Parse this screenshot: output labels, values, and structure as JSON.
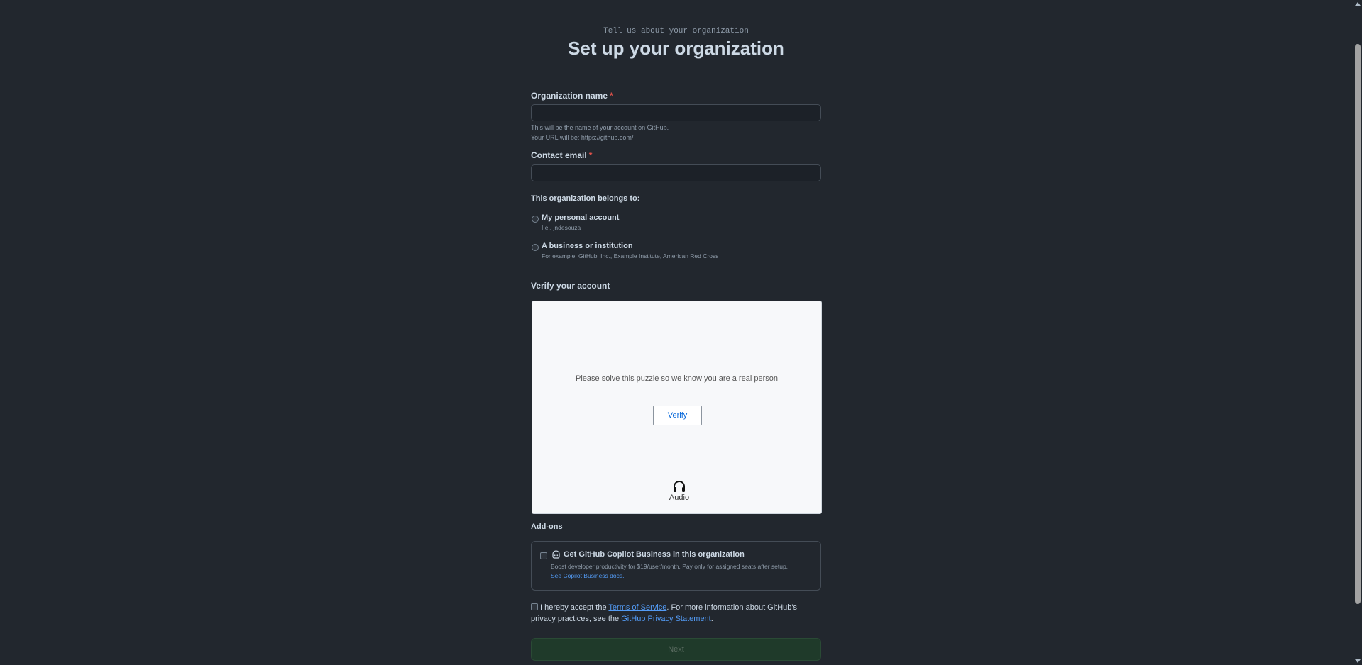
{
  "header": {
    "eyebrow": "Tell us about your organization",
    "title": "Set up your organization"
  },
  "org_name": {
    "label": "Organization name",
    "required_mark": "*",
    "value": "",
    "hint_line1": "This will be the name of your account on GitHub.",
    "hint_line2": "Your URL will be: https://github.com/"
  },
  "contact_email": {
    "label": "Contact email",
    "required_mark": "*",
    "value": ""
  },
  "belongs_to": {
    "label": "This organization belongs to:",
    "options": [
      {
        "title": "My personal account",
        "desc": "I.e., jndesouza",
        "selected": false
      },
      {
        "title": "A business or institution",
        "desc": "For example: GitHub, Inc., Example Institute, American Red Cross",
        "selected": false
      }
    ]
  },
  "verify": {
    "title": "Verify your account",
    "message": "Please solve this puzzle so we know you are a real person",
    "button": "Verify",
    "audio_label": "Audio",
    "audio_icon": "headphones-icon"
  },
  "addons": {
    "title": "Add-ons",
    "copilot": {
      "icon": "copilot-icon",
      "title": "Get GitHub Copilot Business in this organization",
      "desc": "Boost developer productivity for $19/user/month. Pay only for assigned seats after setup.",
      "link": "See Copilot Business docs.",
      "checked": false
    }
  },
  "terms": {
    "prefix": "I hereby accept the",
    "tos_link": "Terms of Service",
    "middle": ". For more information about GitHub's privacy practices, see the",
    "privacy_link": "GitHub Privacy Statement",
    "suffix": ".",
    "checked": false
  },
  "next_button": "Next",
  "colors": {
    "background": "#22272e",
    "required": "#e5534b",
    "link": "#539bf5",
    "next_disabled_bg": "#1f3a2a"
  }
}
